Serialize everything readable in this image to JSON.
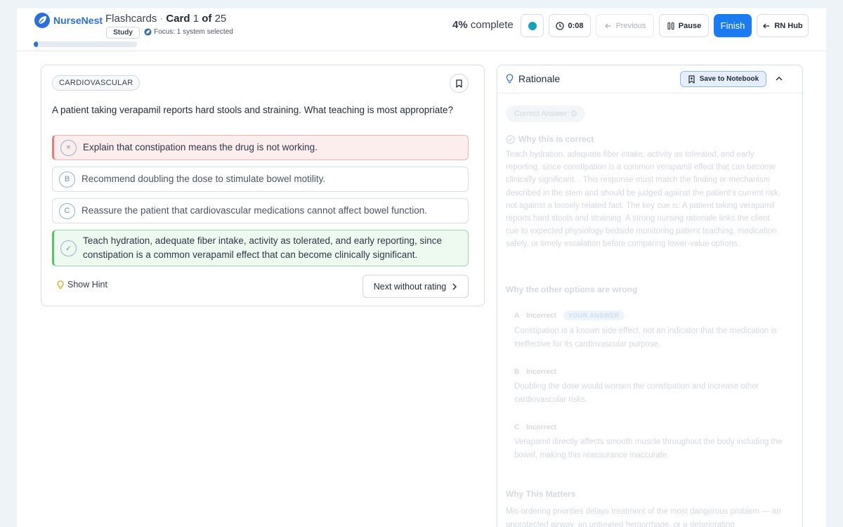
{
  "brand": {
    "name": "NurseNest"
  },
  "header": {
    "section": "Flashcards",
    "card_label": "Card",
    "card_current": "1",
    "card_of": "of",
    "card_total": "25",
    "study_label": "Study",
    "focus_text": "Focus: 1 system selected",
    "progress_fraction": 0.04,
    "percent": "4%",
    "percent_suffix": "complete",
    "timer": "0:08",
    "previous_label": "Previous",
    "pause_label": "Pause",
    "finish_label": "Finish",
    "hub_label": "RN Hub"
  },
  "question": {
    "category": "CARDIOVASCULAR",
    "text": "A patient taking verapamil reports hard stools and straining. What teaching is most appropriate?",
    "options": [
      {
        "letter": "×",
        "text": "Explain that constipation means the drug is not working.",
        "state": "incorrect-selected"
      },
      {
        "letter": "B",
        "text": "Recommend doubling the dose to stimulate bowel motility.",
        "state": "neutral"
      },
      {
        "letter": "C",
        "text": "Reassure the patient that cardiovascular medications cannot affect bowel function.",
        "state": "neutral"
      },
      {
        "letter": "✓",
        "text": "Teach hydration, adequate fiber intake, activity as tolerated, and early reporting, since constipation is a common verapamil effect that can become clinically significant.",
        "state": "correct"
      }
    ],
    "hint_label": "Show Hint",
    "next_label": "Next without rating"
  },
  "rationale": {
    "title": "Rationale",
    "save_label": "Save to Notebook",
    "correct_answer_label": "Correct Answer: D",
    "why_correct_heading": "Why this is correct",
    "why_correct_text": "Teach hydration, adequate fiber intake, activity as tolerated, and early reporting, since constipation is a common verapamil effect that can become clinically significant. . This response must match the finding or mechanism described in the stem and should be judged against the patient's current risk, not against a loosely related fact. The key cue is: A patient taking verapamil reports hard stools and straining. A strong nursing rationale links the client cue to expected physiology bedside monitoring patient teaching, medication safety, or timely escalation before comparing lower-value options.",
    "why_wrong_heading": "Why the other options are wrong",
    "wrong_options": [
      {
        "letter": "A",
        "status": "Incorrect",
        "badge": "YOUR ANSWER",
        "text": "Constipation is a known side effect, not an indicator that the medication is ineffective for its cardiovascular purpose."
      },
      {
        "letter": "B",
        "status": "Incorrect",
        "badge": "",
        "text": "Doubling the dose would worsen the constipation and increase other cardiovascular risks."
      },
      {
        "letter": "C",
        "status": "Incorrect",
        "badge": "",
        "text": "Verapamil directly affects smooth muscle throughout the body including the bowel, making this reassurance inaccurate."
      }
    ],
    "why_matters_heading": "Why This Matters",
    "why_matters_text": "Mis-ordering priorities delays treatment of the most dangerous problem — an unprotected airway, an untreated hemorrhage, or a deteriorating"
  },
  "colors": {
    "brand_blue": "#2a6fdb",
    "finish_blue": "#1a7cf0",
    "status_teal": "#14a3b8",
    "incorrect_red": "#e87b7b",
    "correct_green": "#5bbf6f"
  }
}
